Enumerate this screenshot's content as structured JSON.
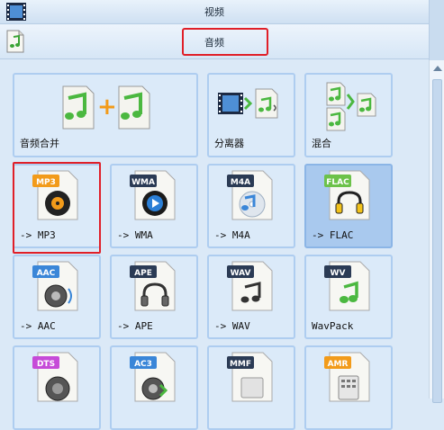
{
  "top": {
    "video_label": "视频"
  },
  "audio": {
    "label": "音频"
  },
  "colors": {
    "highlight": "#e01f28",
    "tile_bg": "#dbeaf9",
    "tile_selected": "#a9c9ee"
  },
  "tiles": [
    {
      "label": "音频合并",
      "icon": "music-merge-icon"
    },
    {
      "label": "分离器",
      "icon": "video-splitter-icon"
    },
    {
      "label": "混合",
      "icon": "audio-mix-icon"
    },
    {
      "label": "-> MP3",
      "badge": "MP3",
      "icon": "mp3-file-icon"
    },
    {
      "label": "-> WMA",
      "badge": "WMA",
      "icon": "wma-file-icon"
    },
    {
      "label": "-> M4A",
      "badge": "M4A",
      "icon": "m4a-file-icon"
    },
    {
      "label": "-> FLAC",
      "badge": "FLAC",
      "icon": "flac-file-icon"
    },
    {
      "label": "-> AAC",
      "badge": "AAC",
      "icon": "aac-file-icon"
    },
    {
      "label": "-> APE",
      "badge": "APE",
      "icon": "ape-file-icon"
    },
    {
      "label": "-> WAV",
      "badge": "WAV",
      "icon": "wav-file-icon"
    },
    {
      "label": "WavPack",
      "badge": "WV",
      "icon": "wavpack-file-icon"
    },
    {
      "label": "",
      "badge": "DTS",
      "icon": "dts-file-icon"
    },
    {
      "label": "",
      "badge": "AC3",
      "icon": "ac3-file-icon"
    },
    {
      "label": "",
      "badge": "MMF",
      "icon": "mmf-file-icon"
    },
    {
      "label": "",
      "badge": "AMR",
      "icon": "amr-file-icon"
    }
  ]
}
